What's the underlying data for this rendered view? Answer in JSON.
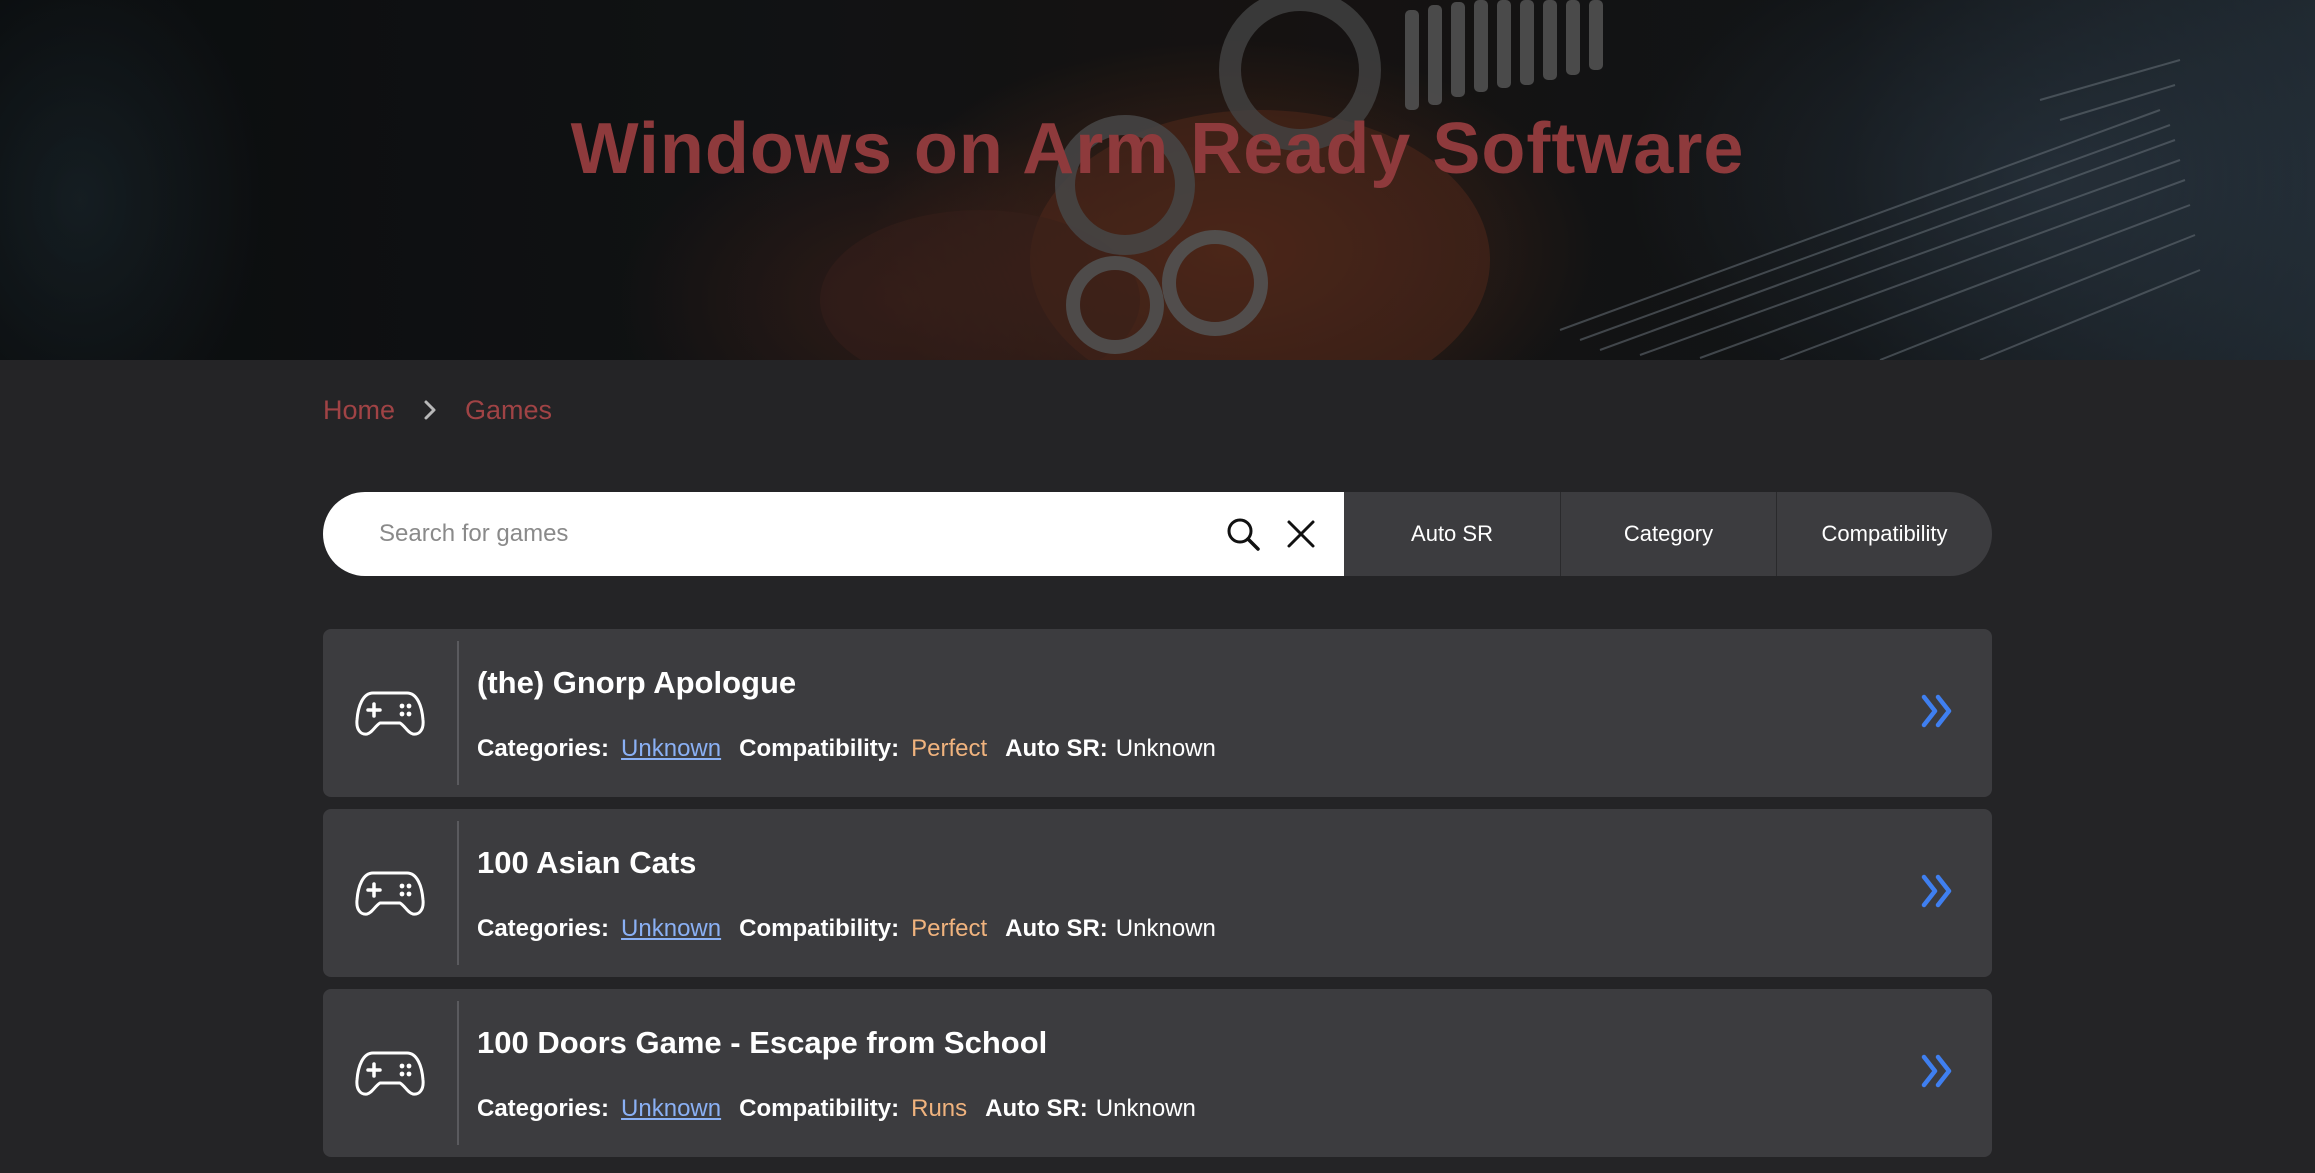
{
  "hero": {
    "title": "Windows on Arm Ready Software"
  },
  "breadcrumb": {
    "items": [
      {
        "label": "Home"
      },
      {
        "label": "Games"
      }
    ]
  },
  "search": {
    "placeholder": "Search for games",
    "value": ""
  },
  "filters": {
    "auto_sr": "Auto SR",
    "category": "Category",
    "compatibility": "Compatibility"
  },
  "labels": {
    "categories": "Categories:",
    "compatibility": "Compatibility:",
    "auto_sr": "Auto SR:"
  },
  "games": [
    {
      "title": "(the) Gnorp Apologue",
      "category": "Unknown",
      "compatibility": "Perfect",
      "auto_sr": "Unknown"
    },
    {
      "title": "100 Asian Cats",
      "category": "Unknown",
      "compatibility": "Perfect",
      "auto_sr": "Unknown"
    },
    {
      "title": "100 Doors Game - Escape from School",
      "category": "Unknown",
      "compatibility": "Runs",
      "auto_sr": "Unknown"
    }
  ],
  "icons": {
    "card_icon": "gamepad-icon",
    "card_action": "double-chevron-right-icon",
    "search": "search-icon",
    "clear": "close-icon",
    "breadcrumb_separator": "chevron-right-icon"
  },
  "colors": {
    "background": "#242426",
    "card_background": "#3c3c3f",
    "accent_red": "#a04345",
    "link_blue": "#8ab0f4",
    "compat_orange": "#f0b37e",
    "arrow_blue": "#3f7ff0"
  }
}
